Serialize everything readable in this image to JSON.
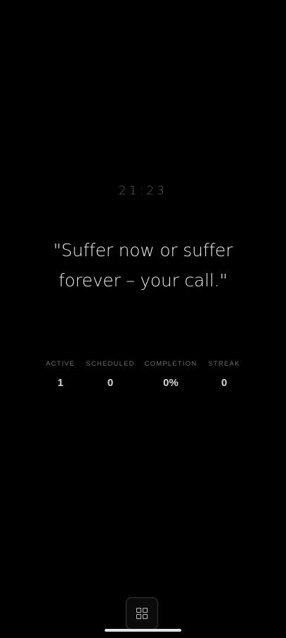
{
  "clock": {
    "time": "21:23"
  },
  "quote": {
    "text": "\"Suffer now or suffer forever – your call.\""
  },
  "stats": [
    {
      "label": "ACTIVE",
      "value": "1"
    },
    {
      "label": "SCHEDULED",
      "value": "0"
    },
    {
      "label": "COMPLETION",
      "value": "0%"
    },
    {
      "label": "STREAK",
      "value": "0"
    }
  ],
  "bottom_bar": {
    "menu_icon": "grid-icon"
  },
  "colors": {
    "background": "#000000",
    "clock": "#5f5f5f",
    "quote": "#e8e8e8",
    "stat_label": "#6e6e6e",
    "stat_value": "#d8d8d8"
  }
}
